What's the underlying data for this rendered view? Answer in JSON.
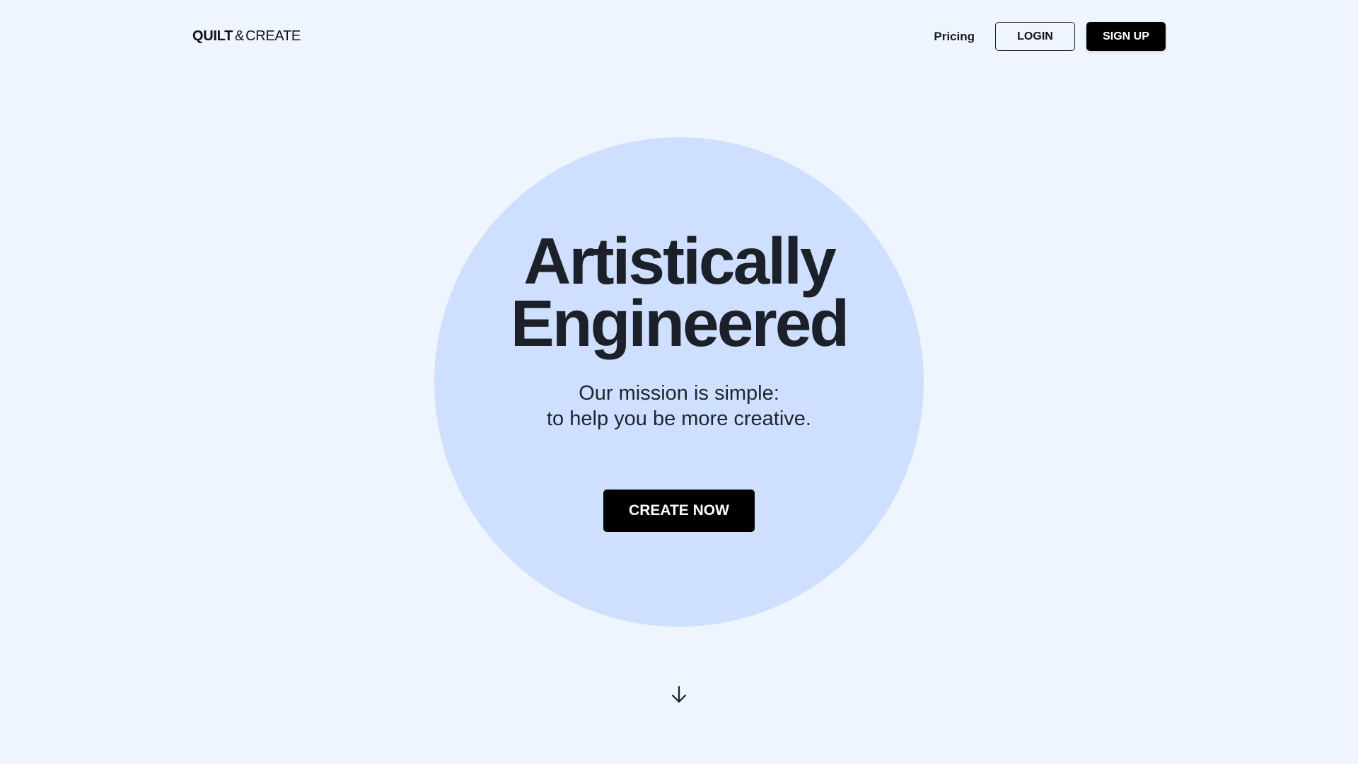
{
  "header": {
    "logo": {
      "bold": "QUILT",
      "amp": "&",
      "light": "CREATE"
    },
    "nav": {
      "pricing_label": "Pricing",
      "login_label": "LOGIN",
      "signup_label": "SIGN UP"
    }
  },
  "hero": {
    "title_line_1": "Artistically",
    "title_line_2": "Engineered",
    "subtitle_line_1": "Our mission is simple:",
    "subtitle_line_2": "to help you be more creative.",
    "cta_label": "CREATE NOW",
    "scroll_icon": "arrow-down-icon"
  },
  "colors": {
    "page_background": "#eff5ff",
    "circle": "#cedfff",
    "text": "#1c2129",
    "button": "#000000",
    "button_text": "#ffffff"
  }
}
